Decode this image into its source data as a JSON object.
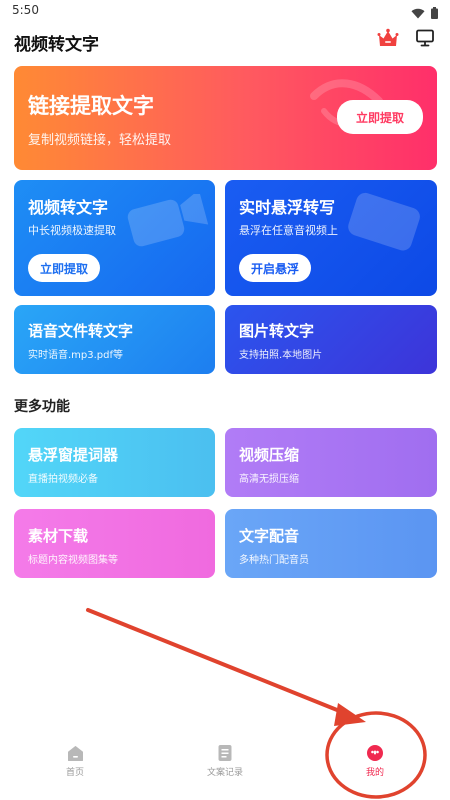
{
  "status_bar": {
    "time": "5:50",
    "wifi_icon": "wifi-icon",
    "battery_icon": "battery-icon"
  },
  "header": {
    "title": "视频转文字",
    "vip_icon": "crown-icon",
    "screen_icon": "monitor-icon"
  },
  "banner": {
    "title": "链接提取文字",
    "subtitle": "复制视频链接，轻松提取",
    "button": "立即提取"
  },
  "tiles": {
    "video_to_text": {
      "title": "视频转文字",
      "subtitle": "中长视频极速提取",
      "button": "立即提取"
    },
    "float_transcribe": {
      "title": "实时悬浮转写",
      "subtitle": "悬浮在任意音视频上",
      "button": "开启悬浮"
    },
    "audio_file": {
      "title": "语音文件转文字",
      "subtitle": "实时语音.mp3.pdf等"
    },
    "image_to_text": {
      "title": "图片转文字",
      "subtitle": "支持拍照.本地图片"
    }
  },
  "more": {
    "section_title": "更多功能",
    "teleprompter": {
      "title": "悬浮窗提词器",
      "subtitle": "直播拍视频必备"
    },
    "video_compress": {
      "title": "视频压缩",
      "subtitle": "高清无损压缩"
    },
    "material_download": {
      "title": "素材下载",
      "subtitle": "标题内容视频图集等"
    },
    "dubbing": {
      "title": "文字配音",
      "subtitle": "多种热门配音员"
    }
  },
  "bottom_nav": {
    "items": [
      {
        "label": "首页",
        "icon": "home-icon",
        "active": false
      },
      {
        "label": "文案记录",
        "icon": "document-icon",
        "active": false
      },
      {
        "label": "我的",
        "icon": "profile-icon",
        "active": true
      }
    ]
  },
  "colors": {
    "accent": "#f0294f",
    "annotation": "#e0432e"
  }
}
